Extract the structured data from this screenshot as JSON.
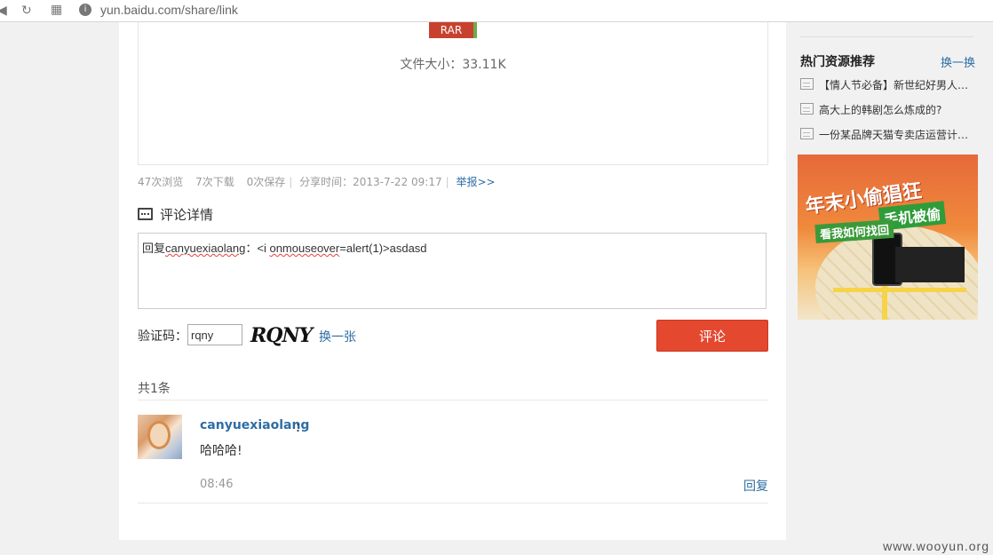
{
  "browser": {
    "url": "yun.baidu.com/share/link"
  },
  "file": {
    "type_badge": "RAR",
    "size_label": "文件大小：33.11K"
  },
  "stats": {
    "views": "47次浏览",
    "downloads": "7次下载",
    "saves": "0次保存",
    "share_time": "分享时间：2013-7-22 09:17",
    "report": "举报>>"
  },
  "comment": {
    "section_title": "评论详情",
    "box_prefix": "回复",
    "box_user": "canyuexiaolang",
    "box_colon": "：<i ",
    "box_attr": "onmouseover",
    "box_rest": "=alert(1)>asdasd",
    "captcha_label": "验证码：",
    "captcha_value": "rqny",
    "captcha_image_text": "RQNY",
    "captcha_refresh": "换一张",
    "submit": "评论",
    "count": "共1条"
  },
  "comments": [
    {
      "user": "canyuexiaolang",
      "colon": "：",
      "text": "哈哈哈!",
      "time": "08:46",
      "reply": "回复"
    }
  ],
  "sidebar": {
    "title": "热门资源推荐",
    "swap": "换一换",
    "items": [
      "【情人节必备】新世纪好男人…",
      "高大上的韩剧怎么炼成的?",
      "一份某品牌天猫专卖店运营计…"
    ],
    "ad": {
      "line1": "年末小偷猖狂",
      "line2": "手机被偷",
      "line3": "看我如何找回"
    }
  },
  "watermark": "www.wooyun.org"
}
